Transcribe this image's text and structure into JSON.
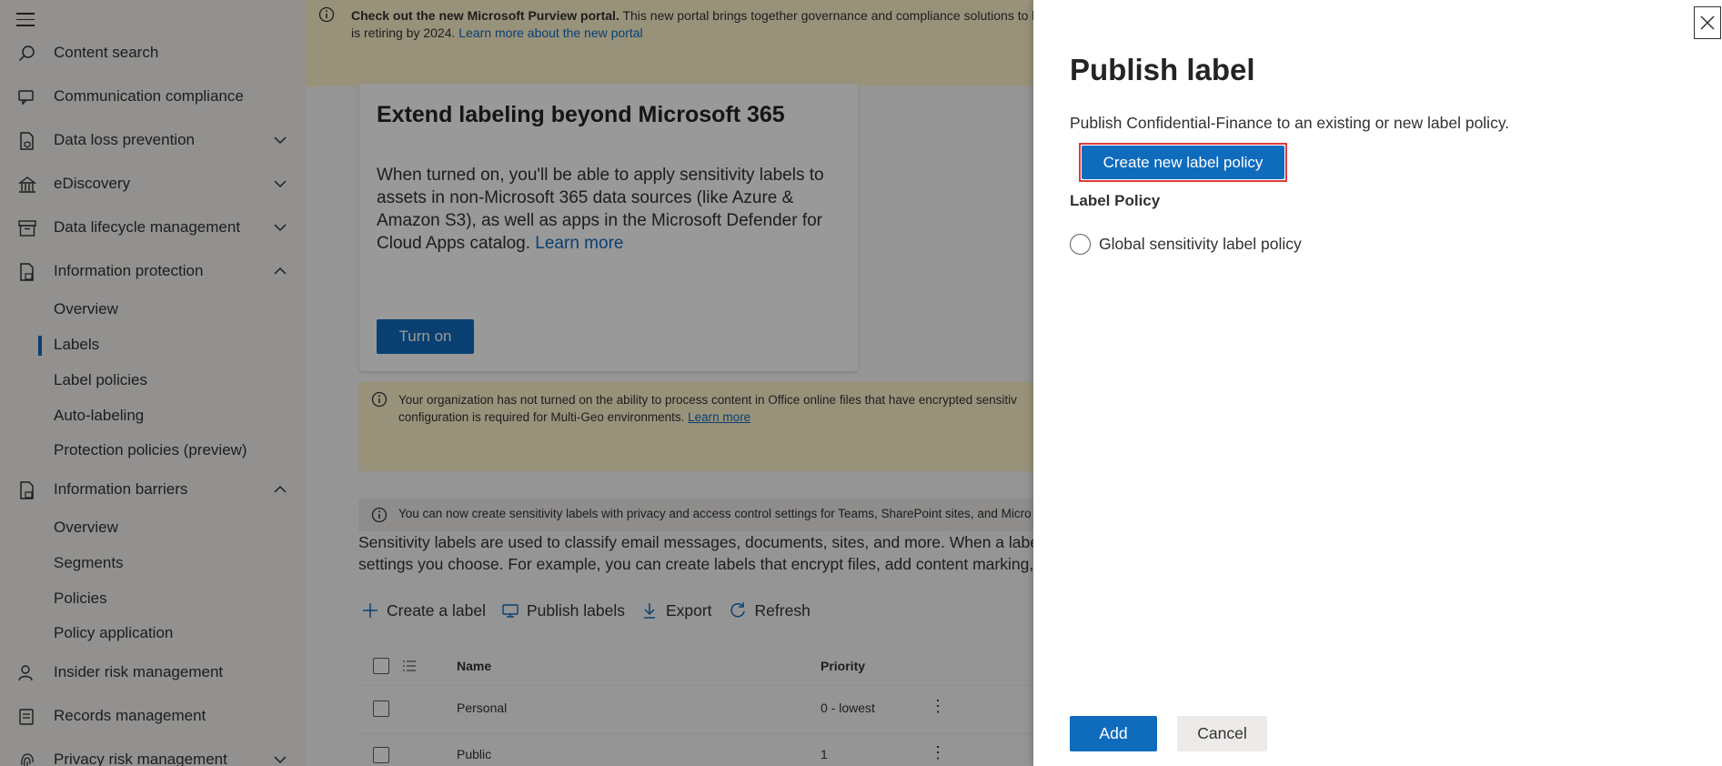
{
  "sidebar": {
    "nav": [
      {
        "label": "Content search"
      },
      {
        "label": "Communication compliance"
      },
      {
        "label": "Data loss prevention"
      },
      {
        "label": "eDiscovery"
      },
      {
        "label": "Data lifecycle management"
      },
      {
        "label": "Information protection"
      },
      {
        "label": "Information barriers"
      },
      {
        "label": "Insider risk management"
      },
      {
        "label": "Records management"
      },
      {
        "label": "Privacy risk management"
      }
    ],
    "info_protection_sub": [
      "Overview",
      "Labels",
      "Label policies",
      "Auto-labeling",
      "Protection policies (preview)"
    ],
    "info_barriers_sub": [
      "Overview",
      "Segments",
      "Policies",
      "Policy application"
    ],
    "selected": "Labels"
  },
  "main": {
    "banner_top": {
      "bold": "Check out the new Microsoft Purview portal.",
      "text": " This new portal brings together governance and compliance solutions to h",
      "line2": "is retiring by 2024. ",
      "link": "Learn more about the new portal"
    },
    "card": {
      "title": "Extend labeling beyond Microsoft 365",
      "body": "When turned on, you'll be able to apply sensitivity labels to assets in non-Microsoft 365 data sources (like Azure & Amazon S3), as well as apps in the Microsoft Defender for Cloud Apps catalog. ",
      "link": "Learn more",
      "button": "Turn on"
    },
    "warn_banner": {
      "line1": "Your organization has not turned on the ability to process content in Office online files that have encrypted sensitiv",
      "line2": "configuration is required for Multi-Geo environments. ",
      "link": "Learn more"
    },
    "info_banner": "You can now create sensitivity labels with privacy and access control settings for Teams, SharePoint sites, and Micro",
    "description": {
      "line1": "Sensitivity labels are used to classify email messages, documents, sites, and more. When a label is",
      "line2": "settings you choose. For example, you can create labels that encrypt files, add content marking, a"
    },
    "toolbar": {
      "create": "Create a label",
      "publish": "Publish labels",
      "export": "Export",
      "refresh": "Refresh"
    },
    "table": {
      "columns": {
        "name": "Name",
        "priority": "Priority"
      },
      "rows": [
        {
          "name": "Personal",
          "priority": "0 - lowest"
        },
        {
          "name": "Public",
          "priority": "1"
        }
      ]
    }
  },
  "panel": {
    "title": "Publish label",
    "description": "Publish Confidential-Finance to an existing or new label policy.",
    "create_button": "Create new label policy",
    "field_label": "Label Policy",
    "options": [
      "Global sensitivity label policy"
    ],
    "add_button": "Add",
    "cancel_button": "Cancel"
  },
  "colors": {
    "accent": "#0f6cbd",
    "banner_yellow": "#fff4ce",
    "focus_outline": "#e0393e"
  }
}
